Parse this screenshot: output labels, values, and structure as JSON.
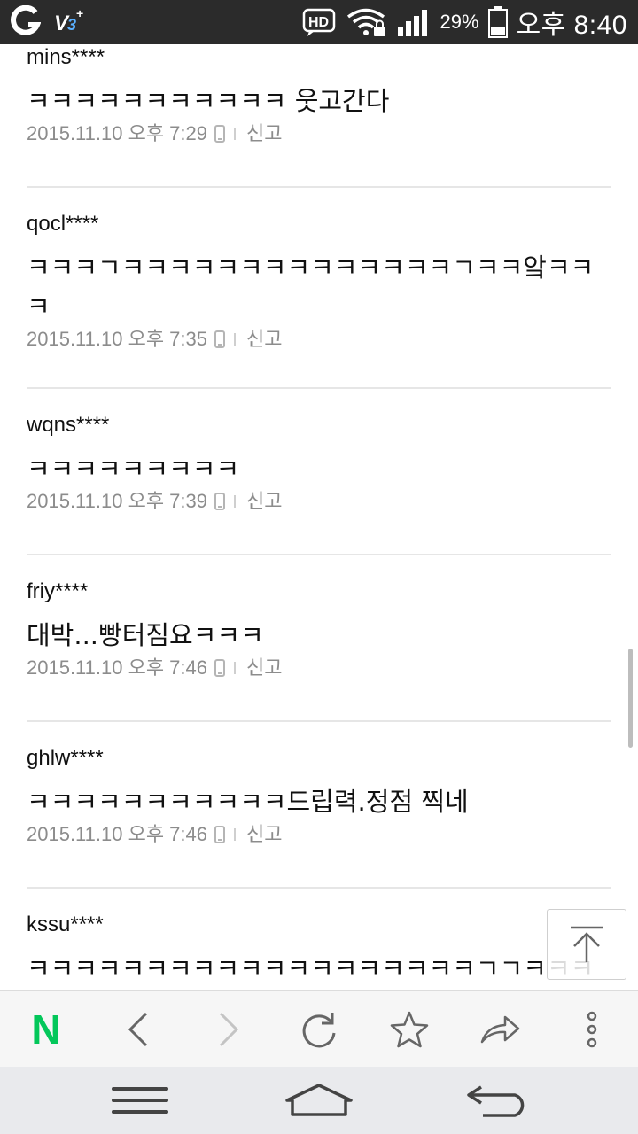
{
  "status_bar": {
    "hd_label": "HD",
    "battery_percent": "29%",
    "time": "오후 8:40"
  },
  "comments": [
    {
      "user": "mins****",
      "text": "ㅋㅋㅋㅋㅋㅋㅋㅋㅋㅋㅋ 웃고간다",
      "date": "2015.11.10 오후 7:29",
      "report": "신고"
    },
    {
      "user": "qocl****",
      "text": "ㅋㅋㅋㄱㅋㅋㅋㅋㅋㅋㅋㅋㅋㅋㅋㅋㅋㅋㄱㅋㅋ앜ㅋㅋㅋ",
      "date": "2015.11.10 오후 7:35",
      "report": "신고"
    },
    {
      "user": "wqns****",
      "text": "ㅋㅋㅋㅋㅋㅋㅋㅋㅋ",
      "date": "2015.11.10 오후 7:39",
      "report": "신고"
    },
    {
      "user": "friy****",
      "text": "대박...빵터짐요ㅋㅋㅋ",
      "date": "2015.11.10 오후 7:46",
      "report": "신고"
    },
    {
      "user": "ghlw****",
      "text": "ㅋㅋㅋㅋㅋㅋㅋㅋㅋㅋㅋ드립력.정점 찍네",
      "date": "2015.11.10 오후 7:46",
      "report": "신고"
    },
    {
      "user": "kssu****",
      "text": "ㅋㅋㅋㅋㅋㅋㅋㅋㅋㅋㅋㅋㅋㅋㅋㅋㅋㅋㅋㄱㄱㅋㅋㅋ",
      "date": "",
      "report": ""
    }
  ],
  "toolbar": {
    "home_label": "N",
    "brand_color": "#03c75a"
  },
  "icons": {
    "back": "chevron-left-icon",
    "forward": "chevron-right-icon",
    "refresh": "refresh-icon",
    "bookmark": "star-icon",
    "share": "share-icon",
    "more": "more-vertical-icon",
    "to_top": "scroll-to-top-icon",
    "menu": "menu-icon",
    "home": "home-icon",
    "nav_back": "back-icon"
  }
}
